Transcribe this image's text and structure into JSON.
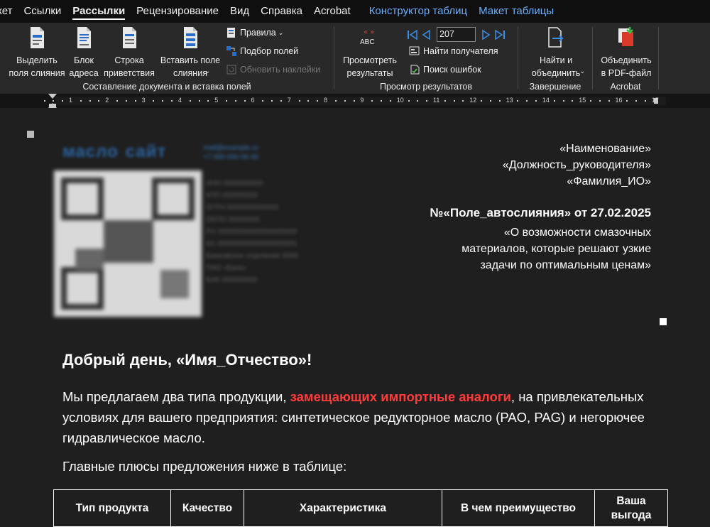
{
  "tabs": [
    {
      "label": "кет",
      "active": false,
      "contextual": false
    },
    {
      "label": "Ссылки",
      "active": false,
      "contextual": false
    },
    {
      "label": "Рассылки",
      "active": true,
      "contextual": false
    },
    {
      "label": "Рецензирование",
      "active": false,
      "contextual": false
    },
    {
      "label": "Вид",
      "active": false,
      "contextual": false
    },
    {
      "label": "Справка",
      "active": false,
      "contextual": false
    },
    {
      "label": "Acrobat",
      "active": false,
      "contextual": false
    },
    {
      "label": "Конструктор таблиц",
      "active": false,
      "contextual": true
    },
    {
      "label": "Макет таблицы",
      "active": false,
      "contextual": true
    }
  ],
  "ribbon": {
    "group_compose": {
      "label": "Составление документа и вставка полей",
      "highlight_fields": "Выделить\nполя слияния",
      "address_block": "Блок\nадреса",
      "greeting_line": "Строка\nприветствия",
      "insert_field": "Вставить поле\nслияния",
      "rules": "Правила",
      "match_fields": "Подбор полей",
      "update_labels": "Обновить наклейки"
    },
    "group_preview": {
      "label": "Просмотр результатов",
      "preview_results": "Просмотреть\nрезультаты",
      "abc": "ABC",
      "record_number": "207",
      "find_recipient": "Найти получателя",
      "check_errors": "Поиск ошибок"
    },
    "group_finish": {
      "label": "Завершение",
      "finish_merge": "Найти и\nобъединить"
    },
    "group_acrobat": {
      "label": "Acrobat",
      "merge_pdf": "Объединить\nв PDF-файл"
    }
  },
  "ruler": {
    "numbers": [
      "1",
      "2",
      "3",
      "4",
      "5",
      "6",
      "7",
      "8",
      "9",
      "10",
      "11",
      "12",
      "13",
      "14",
      "15",
      "16",
      "17"
    ]
  },
  "document": {
    "recipient": {
      "line1": "«Наименование»",
      "line2": "«Должность_руководителя»",
      "line3": "«Фамилия_ИО»"
    },
    "number_line": "№«Поле_автослияния» от 27.02.2025",
    "subject": "«О возможности смазочных материалов, которые решают узкие задачи по оптимальным ценам»",
    "greeting": "Добрый день, «Имя_Отчество»!",
    "paragraph_before": "Мы предлагаем два типа продукции, ",
    "paragraph_highlight": "замещающих импортные аналоги",
    "paragraph_after": ", на привлекательных условиях для вашего предприятия: синтетическое редукторное масло (PAO, PAG) и негорючее гидравлическое масло.",
    "paragraph2": "Главные плюсы предложения ниже в таблице:",
    "table_headers": [
      "Тип продукта",
      "Качество",
      "Характеристика",
      "В чем преимущество",
      "Ваша\nвыгода"
    ]
  },
  "colors": {
    "highlight": "#ff3b3b",
    "contextual_tab": "#6ab0ff",
    "ribbon_bg": "#292929",
    "doc_bg": "#1f1f1f"
  }
}
